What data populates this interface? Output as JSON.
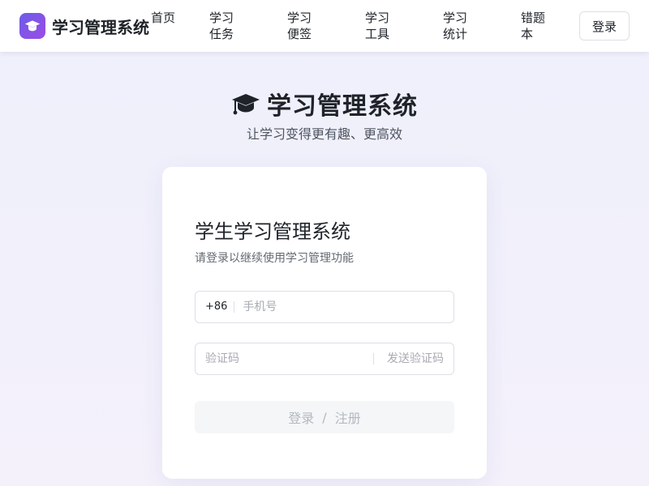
{
  "header": {
    "brand_name": "学习管理系统",
    "nav": [
      {
        "label": "首页"
      },
      {
        "label": "学习任务"
      },
      {
        "label": "学习便签"
      },
      {
        "label": "学习工具"
      },
      {
        "label": "学习统计"
      },
      {
        "label": "错题本"
      }
    ],
    "login_label": "登录",
    "brand_logo_icon": "graduation-cap-icon"
  },
  "hero": {
    "title": "学习管理系统",
    "subtitle": "让学习变得更有趣、更高效",
    "icon": "graduation-cap-icon"
  },
  "login_card": {
    "title": "学生学习管理系统",
    "subtitle": "请登录以继续使用学习管理功能",
    "phone_prefix": "+86",
    "phone_placeholder": "手机号",
    "phone_value": "",
    "code_placeholder": "验证码",
    "code_value": "",
    "send_code_label": "发送验证码",
    "submit_login": "登录",
    "submit_separator": "/",
    "submit_register": "注册"
  },
  "colors": {
    "brand_gradient_start": "#6d5ce8",
    "brand_gradient_end": "#9a4ce6",
    "background": "#eef0fb",
    "disabled_text": "#b4b8bf"
  }
}
